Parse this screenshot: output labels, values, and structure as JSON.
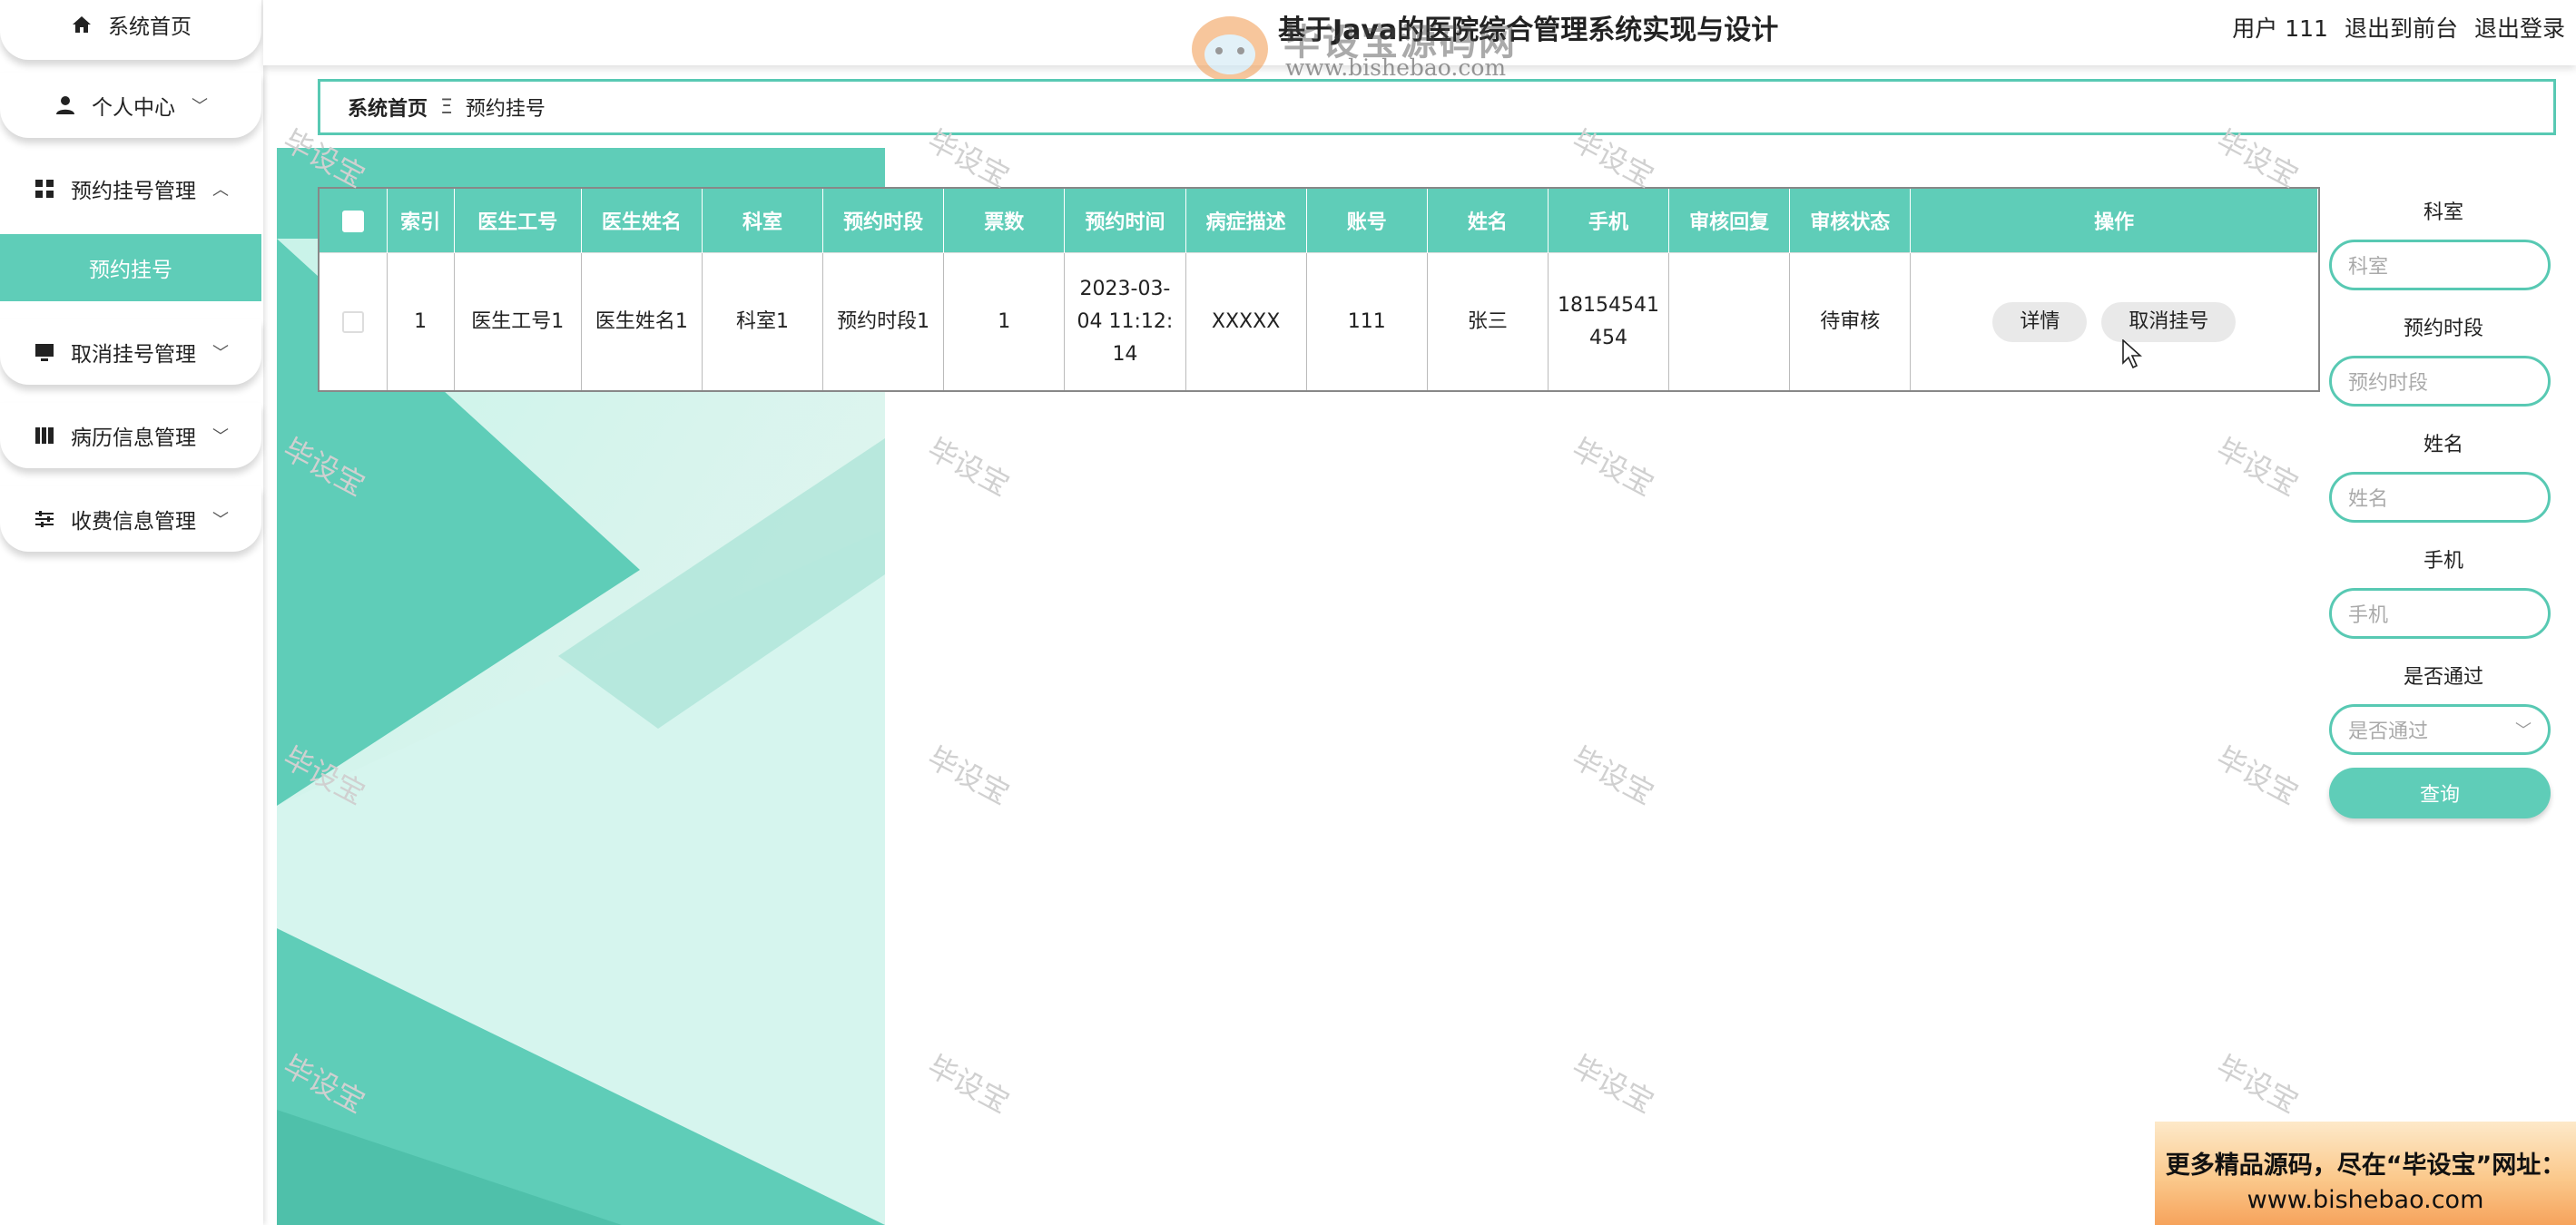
{
  "header": {
    "system_title": "基于Java的医院综合管理系统实现与设计",
    "watermark_brand": "毕设宝源码网",
    "watermark_url": "www.bishebao.com",
    "user_label": "用户 111",
    "exit_front": "退出到前台",
    "logout": "退出登录"
  },
  "sidebar": {
    "items": [
      {
        "label": "系统首页",
        "icon": "home-icon"
      },
      {
        "label": "个人中心",
        "icon": "user-icon"
      },
      {
        "label": "预约挂号管理",
        "icon": "grid-icon"
      },
      {
        "label": "取消挂号管理",
        "icon": "monitor-icon"
      },
      {
        "label": "病历信息管理",
        "icon": "book-icon"
      },
      {
        "label": "收费信息管理",
        "icon": "sliders-icon"
      }
    ],
    "active_sub": "预约挂号"
  },
  "breadcrumb": {
    "home": "系统首页",
    "separator": "Ξ",
    "current": "预约挂号"
  },
  "table": {
    "headers": [
      "索引",
      "医生工号",
      "医生姓名",
      "科室",
      "预约时段",
      "票数",
      "预约时间",
      "病症描述",
      "账号",
      "姓名",
      "手机",
      "审核回复",
      "审核状态",
      "操作"
    ],
    "rows": [
      {
        "index": "1",
        "doctor_no": "医生工号1",
        "doctor_name": "医生姓名1",
        "dept": "科室1",
        "slot": "预约时段1",
        "tickets": "1",
        "time_line1": "2023-03-",
        "time_line2": "04 11:12:",
        "time_line3": "14",
        "desc": "XXXXX",
        "account": "111",
        "name": "张三",
        "phone_line1": "18154541",
        "phone_line2": "454",
        "reply": "",
        "status": "待审核",
        "btn_detail": "详情",
        "btn_cancel": "取消挂号"
      }
    ]
  },
  "search": {
    "dept_label": "科室",
    "dept_placeholder": "科室",
    "slot_label": "预约时段",
    "slot_placeholder": "预约时段",
    "name_label": "姓名",
    "name_placeholder": "姓名",
    "phone_label": "手机",
    "phone_placeholder": "手机",
    "pass_label": "是否通过",
    "pass_placeholder": "是否通过",
    "query_btn": "查询"
  },
  "watermark_text": "毕设宝",
  "promo": {
    "line1": "更多精品源码，尽在“毕设宝”网址：",
    "line2": "www.bishebao.com"
  },
  "colors": {
    "accent": "#5fcdb8",
    "accent_dark": "#4fc0aa"
  }
}
